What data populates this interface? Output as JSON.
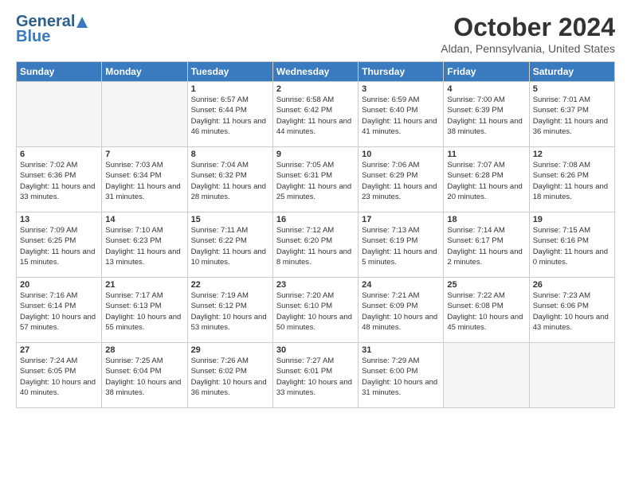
{
  "header": {
    "logo_line1": "General",
    "logo_line2": "Blue",
    "month": "October 2024",
    "location": "Aldan, Pennsylvania, United States"
  },
  "days_of_week": [
    "Sunday",
    "Monday",
    "Tuesday",
    "Wednesday",
    "Thursday",
    "Friday",
    "Saturday"
  ],
  "weeks": [
    [
      {
        "day": "",
        "sunrise": "",
        "sunset": "",
        "daylight": "",
        "empty": true
      },
      {
        "day": "",
        "sunrise": "",
        "sunset": "",
        "daylight": "",
        "empty": true
      },
      {
        "day": "1",
        "sunrise": "Sunrise: 6:57 AM",
        "sunset": "Sunset: 6:44 PM",
        "daylight": "Daylight: 11 hours and 46 minutes.",
        "empty": false
      },
      {
        "day": "2",
        "sunrise": "Sunrise: 6:58 AM",
        "sunset": "Sunset: 6:42 PM",
        "daylight": "Daylight: 11 hours and 44 minutes.",
        "empty": false
      },
      {
        "day": "3",
        "sunrise": "Sunrise: 6:59 AM",
        "sunset": "Sunset: 6:40 PM",
        "daylight": "Daylight: 11 hours and 41 minutes.",
        "empty": false
      },
      {
        "day": "4",
        "sunrise": "Sunrise: 7:00 AM",
        "sunset": "Sunset: 6:39 PM",
        "daylight": "Daylight: 11 hours and 38 minutes.",
        "empty": false
      },
      {
        "day": "5",
        "sunrise": "Sunrise: 7:01 AM",
        "sunset": "Sunset: 6:37 PM",
        "daylight": "Daylight: 11 hours and 36 minutes.",
        "empty": false
      }
    ],
    [
      {
        "day": "6",
        "sunrise": "Sunrise: 7:02 AM",
        "sunset": "Sunset: 6:36 PM",
        "daylight": "Daylight: 11 hours and 33 minutes.",
        "empty": false
      },
      {
        "day": "7",
        "sunrise": "Sunrise: 7:03 AM",
        "sunset": "Sunset: 6:34 PM",
        "daylight": "Daylight: 11 hours and 31 minutes.",
        "empty": false
      },
      {
        "day": "8",
        "sunrise": "Sunrise: 7:04 AM",
        "sunset": "Sunset: 6:32 PM",
        "daylight": "Daylight: 11 hours and 28 minutes.",
        "empty": false
      },
      {
        "day": "9",
        "sunrise": "Sunrise: 7:05 AM",
        "sunset": "Sunset: 6:31 PM",
        "daylight": "Daylight: 11 hours and 25 minutes.",
        "empty": false
      },
      {
        "day": "10",
        "sunrise": "Sunrise: 7:06 AM",
        "sunset": "Sunset: 6:29 PM",
        "daylight": "Daylight: 11 hours and 23 minutes.",
        "empty": false
      },
      {
        "day": "11",
        "sunrise": "Sunrise: 7:07 AM",
        "sunset": "Sunset: 6:28 PM",
        "daylight": "Daylight: 11 hours and 20 minutes.",
        "empty": false
      },
      {
        "day": "12",
        "sunrise": "Sunrise: 7:08 AM",
        "sunset": "Sunset: 6:26 PM",
        "daylight": "Daylight: 11 hours and 18 minutes.",
        "empty": false
      }
    ],
    [
      {
        "day": "13",
        "sunrise": "Sunrise: 7:09 AM",
        "sunset": "Sunset: 6:25 PM",
        "daylight": "Daylight: 11 hours and 15 minutes.",
        "empty": false
      },
      {
        "day": "14",
        "sunrise": "Sunrise: 7:10 AM",
        "sunset": "Sunset: 6:23 PM",
        "daylight": "Daylight: 11 hours and 13 minutes.",
        "empty": false
      },
      {
        "day": "15",
        "sunrise": "Sunrise: 7:11 AM",
        "sunset": "Sunset: 6:22 PM",
        "daylight": "Daylight: 11 hours and 10 minutes.",
        "empty": false
      },
      {
        "day": "16",
        "sunrise": "Sunrise: 7:12 AM",
        "sunset": "Sunset: 6:20 PM",
        "daylight": "Daylight: 11 hours and 8 minutes.",
        "empty": false
      },
      {
        "day": "17",
        "sunrise": "Sunrise: 7:13 AM",
        "sunset": "Sunset: 6:19 PM",
        "daylight": "Daylight: 11 hours and 5 minutes.",
        "empty": false
      },
      {
        "day": "18",
        "sunrise": "Sunrise: 7:14 AM",
        "sunset": "Sunset: 6:17 PM",
        "daylight": "Daylight: 11 hours and 2 minutes.",
        "empty": false
      },
      {
        "day": "19",
        "sunrise": "Sunrise: 7:15 AM",
        "sunset": "Sunset: 6:16 PM",
        "daylight": "Daylight: 11 hours and 0 minutes.",
        "empty": false
      }
    ],
    [
      {
        "day": "20",
        "sunrise": "Sunrise: 7:16 AM",
        "sunset": "Sunset: 6:14 PM",
        "daylight": "Daylight: 10 hours and 57 minutes.",
        "empty": false
      },
      {
        "day": "21",
        "sunrise": "Sunrise: 7:17 AM",
        "sunset": "Sunset: 6:13 PM",
        "daylight": "Daylight: 10 hours and 55 minutes.",
        "empty": false
      },
      {
        "day": "22",
        "sunrise": "Sunrise: 7:19 AM",
        "sunset": "Sunset: 6:12 PM",
        "daylight": "Daylight: 10 hours and 53 minutes.",
        "empty": false
      },
      {
        "day": "23",
        "sunrise": "Sunrise: 7:20 AM",
        "sunset": "Sunset: 6:10 PM",
        "daylight": "Daylight: 10 hours and 50 minutes.",
        "empty": false
      },
      {
        "day": "24",
        "sunrise": "Sunrise: 7:21 AM",
        "sunset": "Sunset: 6:09 PM",
        "daylight": "Daylight: 10 hours and 48 minutes.",
        "empty": false
      },
      {
        "day": "25",
        "sunrise": "Sunrise: 7:22 AM",
        "sunset": "Sunset: 6:08 PM",
        "daylight": "Daylight: 10 hours and 45 minutes.",
        "empty": false
      },
      {
        "day": "26",
        "sunrise": "Sunrise: 7:23 AM",
        "sunset": "Sunset: 6:06 PM",
        "daylight": "Daylight: 10 hours and 43 minutes.",
        "empty": false
      }
    ],
    [
      {
        "day": "27",
        "sunrise": "Sunrise: 7:24 AM",
        "sunset": "Sunset: 6:05 PM",
        "daylight": "Daylight: 10 hours and 40 minutes.",
        "empty": false
      },
      {
        "day": "28",
        "sunrise": "Sunrise: 7:25 AM",
        "sunset": "Sunset: 6:04 PM",
        "daylight": "Daylight: 10 hours and 38 minutes.",
        "empty": false
      },
      {
        "day": "29",
        "sunrise": "Sunrise: 7:26 AM",
        "sunset": "Sunset: 6:02 PM",
        "daylight": "Daylight: 10 hours and 36 minutes.",
        "empty": false
      },
      {
        "day": "30",
        "sunrise": "Sunrise: 7:27 AM",
        "sunset": "Sunset: 6:01 PM",
        "daylight": "Daylight: 10 hours and 33 minutes.",
        "empty": false
      },
      {
        "day": "31",
        "sunrise": "Sunrise: 7:29 AM",
        "sunset": "Sunset: 6:00 PM",
        "daylight": "Daylight: 10 hours and 31 minutes.",
        "empty": false
      },
      {
        "day": "",
        "sunrise": "",
        "sunset": "",
        "daylight": "",
        "empty": true
      },
      {
        "day": "",
        "sunrise": "",
        "sunset": "",
        "daylight": "",
        "empty": true
      }
    ]
  ]
}
